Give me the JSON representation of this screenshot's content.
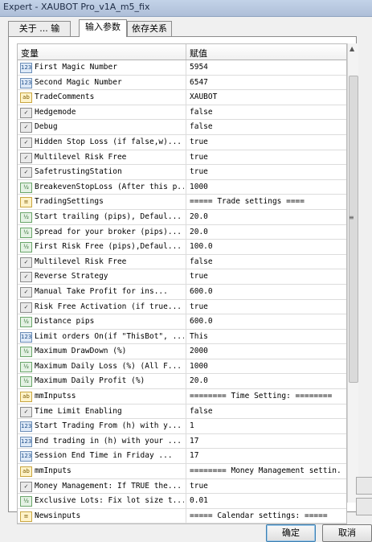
{
  "window": {
    "title": "Expert - XAUBOT Pro_v1A_m5_fix"
  },
  "tabs": [
    {
      "label": "关于 ... 输",
      "active": false
    },
    {
      "label": "输入参数",
      "active": true
    },
    {
      "label": "依存关系",
      "active": false
    }
  ],
  "table": {
    "headers": {
      "variable": "变量",
      "value": "赋值"
    },
    "rows": [
      {
        "type": "123",
        "name": "First Magic Number",
        "value": "5954"
      },
      {
        "type": "123",
        "name": "Second Magic Number",
        "value": "6547"
      },
      {
        "type": "ab",
        "name": "TradeComments",
        "value": "XAUBOT"
      },
      {
        "type": "bool",
        "name": "Hedgemode",
        "value": "false"
      },
      {
        "type": "bool",
        "name": "Debug",
        "value": "false"
      },
      {
        "type": "bool",
        "name": "Hidden Stop Loss (if false,w)...",
        "value": "true"
      },
      {
        "type": "bool",
        "name": "Multilevel Risk Free",
        "value": "true"
      },
      {
        "type": "bool",
        "name": "SafetrustingStation",
        "value": "true"
      },
      {
        "type": "1/2",
        "name": "BreakevenStopLoss (After this p...",
        "value": "1000"
      },
      {
        "type": "enum",
        "name": "TradingSettings",
        "value": "===== Trade settings ===="
      },
      {
        "type": "1/2",
        "name": "Start trailing (pips), Defaul...",
        "value": "20.0"
      },
      {
        "type": "1/2",
        "name": "Spread for your broker (pips)...",
        "value": "20.0"
      },
      {
        "type": "1/2",
        "name": "First Risk Free (pips),Defaul...",
        "value": "100.0"
      },
      {
        "type": "bool",
        "name": "Multilevel Risk Free",
        "value": "false"
      },
      {
        "type": "bool",
        "name": "Reverse Strategy",
        "value": "true"
      },
      {
        "type": "bool",
        "name": "Manual Take Profit for ins...",
        "value": "600.0"
      },
      {
        "type": "bool",
        "name": "Risk Free Activation (if true...",
        "value": "true"
      },
      {
        "type": "1/2",
        "name": "Distance pips",
        "value": "600.0"
      },
      {
        "type": "123",
        "name": "Limit orders On(if \"ThisBot\", ...",
        "value": "This"
      },
      {
        "type": "1/2",
        "name": "Maximum DrawDown (%)",
        "value": "2000"
      },
      {
        "type": "1/2",
        "name": "Maximum Daily Loss (%) (All F...",
        "value": "1000"
      },
      {
        "type": "1/2",
        "name": "Maximum Daily Profit (%)",
        "value": "20.0"
      },
      {
        "type": "ab",
        "name": "mmInputss",
        "value": "======== Time Setting: ========"
      },
      {
        "type": "bool",
        "name": "Time Limit Enabling",
        "value": "false"
      },
      {
        "type": "123",
        "name": "Start Trading From (h) with y...",
        "value": "1"
      },
      {
        "type": "123",
        "name": "End trading in (h) with your ...",
        "value": "17"
      },
      {
        "type": "123",
        "name": "Session End Time in Friday ...",
        "value": "17"
      },
      {
        "type": "ab",
        "name": "mmInputs",
        "value": "======== Money Management settin..."
      },
      {
        "type": "bool",
        "name": "Money Management: If TRUE the...",
        "value": "true"
      },
      {
        "type": "1/2",
        "name": "Exclusive Lots: Fix lot size t...",
        "value": "0.01"
      },
      {
        "type": "enum",
        "name": "Newsinputs",
        "value": "===== Calendar settings: ====="
      }
    ]
  },
  "buttons": {
    "ok": "确定",
    "cancel": "取消"
  },
  "colors": {
    "titlebar": "#b7c8df",
    "selection": "#ffffff"
  }
}
